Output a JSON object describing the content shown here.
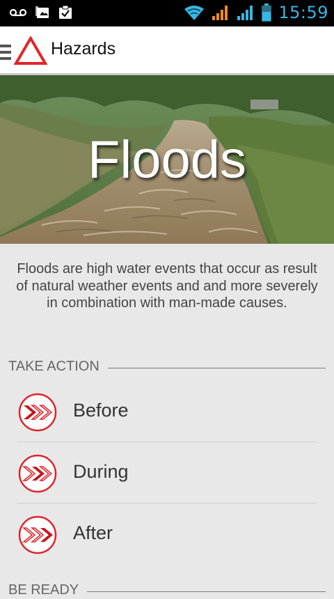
{
  "status_bar": {
    "time": "15:59",
    "icons": [
      "voicemail-icon",
      "image-icon",
      "clipboard-check-icon",
      "wifi-icon",
      "signal-orange-icon",
      "signal-blue-icon",
      "battery-icon"
    ],
    "time_color": "#37b6e6"
  },
  "header": {
    "title": "Hazards",
    "accent_color": "#e0242b"
  },
  "hero": {
    "title": "Floods"
  },
  "description": "Floods are high water events that occur as result of natural weather events and and more severely in combination with man-made causes.",
  "sections": {
    "take_action": "TAKE ACTION",
    "be_ready": "BE READY"
  },
  "actions": [
    {
      "label": "Before",
      "icon": "before-chevrons-icon"
    },
    {
      "label": "During",
      "icon": "during-chevrons-icon"
    },
    {
      "label": "After",
      "icon": "after-chevrons-icon"
    }
  ]
}
